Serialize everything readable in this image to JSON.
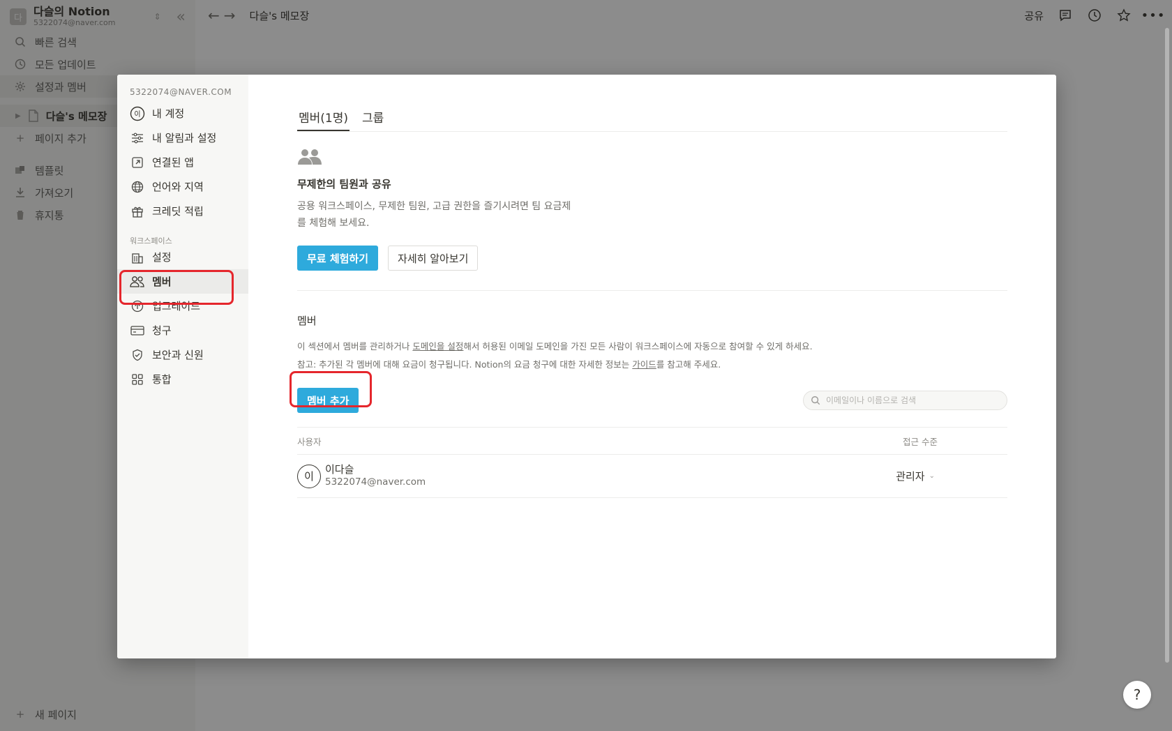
{
  "workspace": {
    "avatar_letter": "다",
    "name": "다슬의 Notion",
    "email": "5322074@naver.com"
  },
  "sidebar": {
    "quick_search": "빠른 검색",
    "all_updates": "모든 업데이트",
    "settings_members": "설정과 멤버",
    "page_title": "다슬's 메모장",
    "add_page": "페이지 추가",
    "templates": "템플릿",
    "import": "가져오기",
    "trash": "휴지통",
    "new_page": "새 페이지"
  },
  "topbar": {
    "breadcrumb": "다슬's 메모장",
    "share": "공유"
  },
  "help_label": "?",
  "settings_modal": {
    "account_email": "5322074@NAVER.COM",
    "account_items": [
      {
        "label": "내 계정"
      },
      {
        "label": "내 알림과 설정"
      },
      {
        "label": "연결된 앱"
      },
      {
        "label": "언어와 지역"
      },
      {
        "label": "크레딧 적립"
      }
    ],
    "workspace_section": "워크스페이스",
    "workspace_items": [
      {
        "label": "설정"
      },
      {
        "label": "멤버"
      },
      {
        "label": "업그레이드"
      },
      {
        "label": "청구"
      },
      {
        "label": "보안과 신원"
      },
      {
        "label": "통합"
      }
    ],
    "tabs": [
      {
        "label": "멤버(1명)",
        "active": true
      },
      {
        "label": "그룹",
        "active": false
      }
    ],
    "upsell": {
      "title": "무제한의 팀원과 공유",
      "description": "공용 워크스페이스, 무제한 팀원, 고급 권한을 즐기시려면 팀 요금제를 체험해 보세요.",
      "trial_button": "무료 체험하기",
      "learn_more_button": "자세히 알아보기"
    },
    "members": {
      "heading": "멤버",
      "desc_line1_part1": "이 섹션에서 멤버를 관리하거나 ",
      "desc_line1_link": "도메인을 설정",
      "desc_line1_part2": "해서 허용된 이메일 도메인을 가진 모든 사람이 워크스페이스에 자동으로 참여할 수 있게 하세요.",
      "desc_line2_part1": "참고: 추가된 각 멤버에 대해 요금이 청구됩니다. Notion의 요금 청구에 대한 자세한 정보는 ",
      "desc_line2_link": "가이드",
      "desc_line2_part2": "를 참고해 주세요.",
      "add_button": "멤버 추가",
      "search_placeholder": "이메일이나 이름으로 검색",
      "columns": {
        "user": "사용자",
        "access": "접근 수준"
      },
      "rows": [
        {
          "avatar": "이",
          "name": "이다슬",
          "email": "5322074@naver.com",
          "role": "관리자"
        }
      ]
    }
  },
  "colors": {
    "accent_blue": "#2eaadc",
    "highlight_red": "#e5262c",
    "sidebar_bg": "#f7f7f5"
  }
}
